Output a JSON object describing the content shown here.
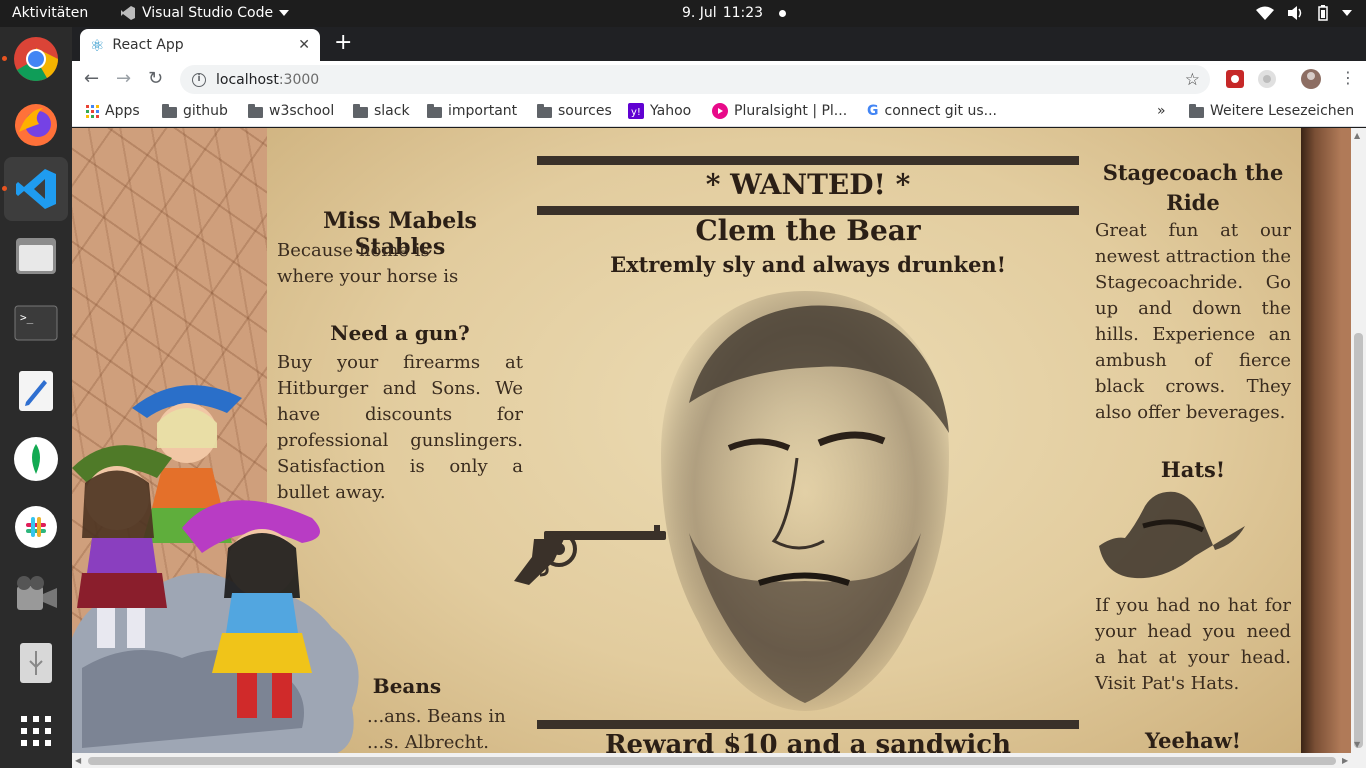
{
  "system": {
    "activities": "Aktivitäten",
    "app_name": "Visual Studio Code",
    "date": "9. Jul",
    "time": "11:23"
  },
  "dock": {
    "items": [
      "chrome-icon",
      "firefox-icon",
      "vscode-icon",
      "files-icon",
      "terminal-icon",
      "text-editor-icon",
      "mongodb-icon",
      "slack-icon",
      "video-icon",
      "usb-icon",
      "app-grid-icon"
    ]
  },
  "browser": {
    "tab_title": "React App",
    "url_host": "localhost",
    "url_port": ":3000",
    "bookmarks": [
      {
        "label": "Apps",
        "icon": "apps-grid-icon"
      },
      {
        "label": "github",
        "icon": "folder-icon"
      },
      {
        "label": "w3school",
        "icon": "folder-icon"
      },
      {
        "label": "slack",
        "icon": "folder-icon"
      },
      {
        "label": "important",
        "icon": "folder-icon"
      },
      {
        "label": "sources",
        "icon": "folder-icon"
      },
      {
        "label": "Yahoo",
        "icon": "yahoo-icon"
      },
      {
        "label": "Pluralsight | Pl...",
        "icon": "pluralsight-icon"
      },
      {
        "label": "connect git us...",
        "icon": "google-icon"
      }
    ],
    "more_bookmarks": "»",
    "other_bookmarks": "Weitere Lesezeichen"
  },
  "page": {
    "left": {
      "stables_title": "Miss Mabels Stables",
      "stables_text": "Because home is where your horse is",
      "gun_title": "Need a gun?",
      "gun_text": "Buy your firearms at Hitburger and Sons. We have discounts for professional gunslingers. Satisfaction is only a bullet away.",
      "beans_title": "Beans",
      "beans_text": "...ans. Beans in ...s. Albrecht."
    },
    "center": {
      "wanted": "* WANTED! *",
      "name": "Clem the Bear",
      "subtitle": "Extremly sly and always drunken!",
      "reward": "Reward $10 and a sandwich"
    },
    "right": {
      "stage_title": "Stagecoach the Ride",
      "stage_text": "Great fun at our newest attraction the Stagecoachride. Go up and down the hills. Experience an ambush of fierce black crows. They also offer beverages.",
      "hats_title": "Hats!",
      "hats_text": "If you had no hat for your head you need a hat at your head. Visit Pat's Hats.",
      "yeehaw_title": "Yeehaw!"
    }
  },
  "colors": {
    "paper": "#e2cc9e",
    "ink": "#3a2c1f",
    "chrome_dark": "#202124",
    "ubuntu_accent": "#e95420"
  }
}
